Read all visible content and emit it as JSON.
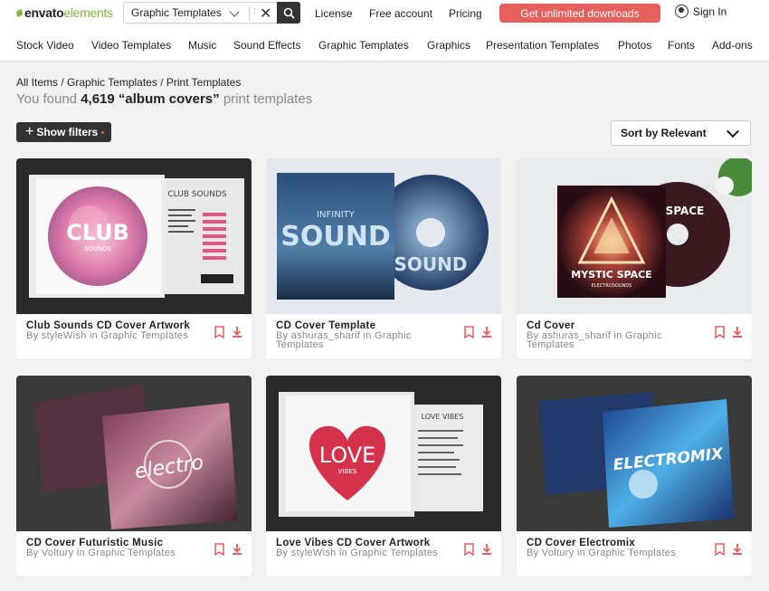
{
  "header": {
    "logo_text": "envato",
    "logo_sub": "elements",
    "search_category": "Graphic Templates",
    "links": [
      "License",
      "Free account",
      "Pricing"
    ],
    "cta": "Get unlimited downloads",
    "signin": "Sign In",
    "accent": "#e55f5c",
    "brand_green": "#82b541"
  },
  "nav": [
    "Stock Video",
    "Video Templates",
    "Music",
    "Sound Effects",
    "Graphic Templates",
    "Graphics",
    "Presentation Templates",
    "Photos",
    "Fonts",
    "Add-ons"
  ],
  "breadcrumb": {
    "items": [
      "All Items",
      "Graphic Templates",
      "Print Templates"
    ]
  },
  "results": {
    "prefix": "You found",
    "count": "4,619",
    "query": "“album covers”",
    "suffix": "print templates"
  },
  "filters": {
    "label": "Show filters"
  },
  "sort": {
    "selected": "Sort by Relevant"
  },
  "cards": [
    {
      "title": "Club Sounds CD Cover Artwork",
      "by": "By styleWish in Graphic Templates",
      "art_text": "CLUB",
      "art_sub": "SOUNDS",
      "side_text": "CLUB SOUNDS"
    },
    {
      "title": "CD Cover Template",
      "by": "By ashuras_sharif in Graphic Templates",
      "art_text": "SOUND",
      "art_sub": "INFINITY",
      "side_text": "SOUND"
    },
    {
      "title": "Cd Cover",
      "by": "By ashuras_sharif in Graphic Templates",
      "art_text": "MYSTIC SPACE",
      "art_sub": "ELECTROSOUNDS",
      "side_text": "SPACE"
    },
    {
      "title": "CD Cover Futuristic Music",
      "by": "By Voltury in Graphic Templates",
      "art_text": "electro",
      "art_sub": "",
      "side_text": ""
    },
    {
      "title": "Love Vibes CD Cover Artwork",
      "by": "By styleWish in Graphic Templates",
      "art_text": "LOVE",
      "art_sub": "VIBES",
      "side_text": "LOVE VIBES"
    },
    {
      "title": "CD Cover Electromix",
      "by": "By Voltury in Graphic Templates",
      "art_text": "ELECTROMIX",
      "art_sub": "",
      "side_text": ""
    }
  ]
}
